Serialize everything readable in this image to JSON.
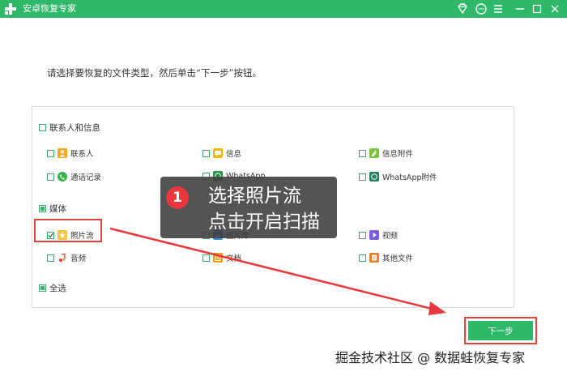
{
  "window": {
    "title": "安卓恢复专家"
  },
  "instruction": "请选择要恢复的文件类型，然后单击“下一步”按钮。",
  "groups": {
    "contacts": {
      "label": "联系人和信息",
      "items": [
        "联系人",
        "信息",
        "信息附件",
        "通话记录",
        "WhatsApp",
        "WhatsApp附件"
      ]
    },
    "media": {
      "label": "媒体",
      "items": [
        "照片流",
        "图片库",
        "视频",
        "音频",
        "文档",
        "其他文件"
      ]
    },
    "select_all": "全选"
  },
  "next_button": "下一步",
  "callout": {
    "step": "1",
    "line1": "选择照片流",
    "line2": "点击开启扫描"
  },
  "watermark": "掘金技术社区 @ 数据蛙恢复专家",
  "colors": {
    "brand_green": "#2fb86a",
    "highlight_red": "#e0453c"
  }
}
